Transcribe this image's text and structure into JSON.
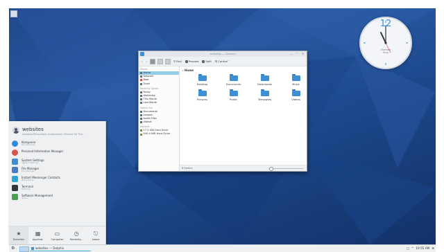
{
  "desktop": {
    "background_colors": [
      "#20478a",
      "#2b5aa3",
      "#13326a"
    ]
  },
  "clock_widget": {
    "twelve": "12",
    "location": "Oversaw\nRing"
  },
  "dolphin": {
    "title": "websites — Dolphin",
    "toolbar": {
      "find": "Find",
      "preview": "Preview",
      "split": "Split",
      "control": "Control"
    },
    "sidebar": {
      "places_header": "Places",
      "places": [
        "Home",
        "Network",
        "Root",
        "Trash"
      ],
      "recent_header": "Recently Saved",
      "recent": [
        "Today",
        "Yesterday",
        "This Month",
        "Last Month"
      ],
      "search_header": "Search For",
      "search": [
        "Documents",
        "Images",
        "Audio Files",
        "Videos"
      ],
      "devices_header": "Devices",
      "devices": [
        "17.5 GiB Hard Drive",
        "500.4 MiB Hard Drive"
      ]
    },
    "breadcrumb": "Home",
    "folders": [
      "Desktop",
      "Documents",
      "Downloads",
      "Music",
      "Pictures",
      "Public",
      "Templates",
      "Videos"
    ],
    "status": "8 Folders",
    "accent": "#3d8fd6"
  },
  "launcher": {
    "user_name": "websites",
    "user_host": "websites@localhost.localdomain (Fedora 30 The...",
    "apps": [
      {
        "name": "Konqueror",
        "desc": "Web Browser",
        "color": "#2f8ae0"
      },
      {
        "name": "Personal Information Manager",
        "desc": "",
        "color": "#d9534f"
      },
      {
        "name": "System Settings",
        "desc": "System Settings",
        "color": "#3d8fd6"
      },
      {
        "name": "File Manager",
        "desc": "File Manager",
        "color": "#4a7cc4"
      },
      {
        "name": "Instant Messenger Contacts",
        "desc": "IM Contacts",
        "color": "#2aa6d6"
      },
      {
        "name": "Terminal",
        "desc": "Terminal",
        "color": "#31363b"
      },
      {
        "name": "Software Management",
        "desc": "Apper",
        "color": "#4aa154"
      }
    ],
    "tabs": [
      "Favorites",
      "Applicat.",
      "Computer",
      "Recently...",
      "Leave"
    ]
  },
  "panel": {
    "task_label": "websites — Dolphin",
    "clock": "10:55 AM",
    "tray_arrow": "^"
  }
}
